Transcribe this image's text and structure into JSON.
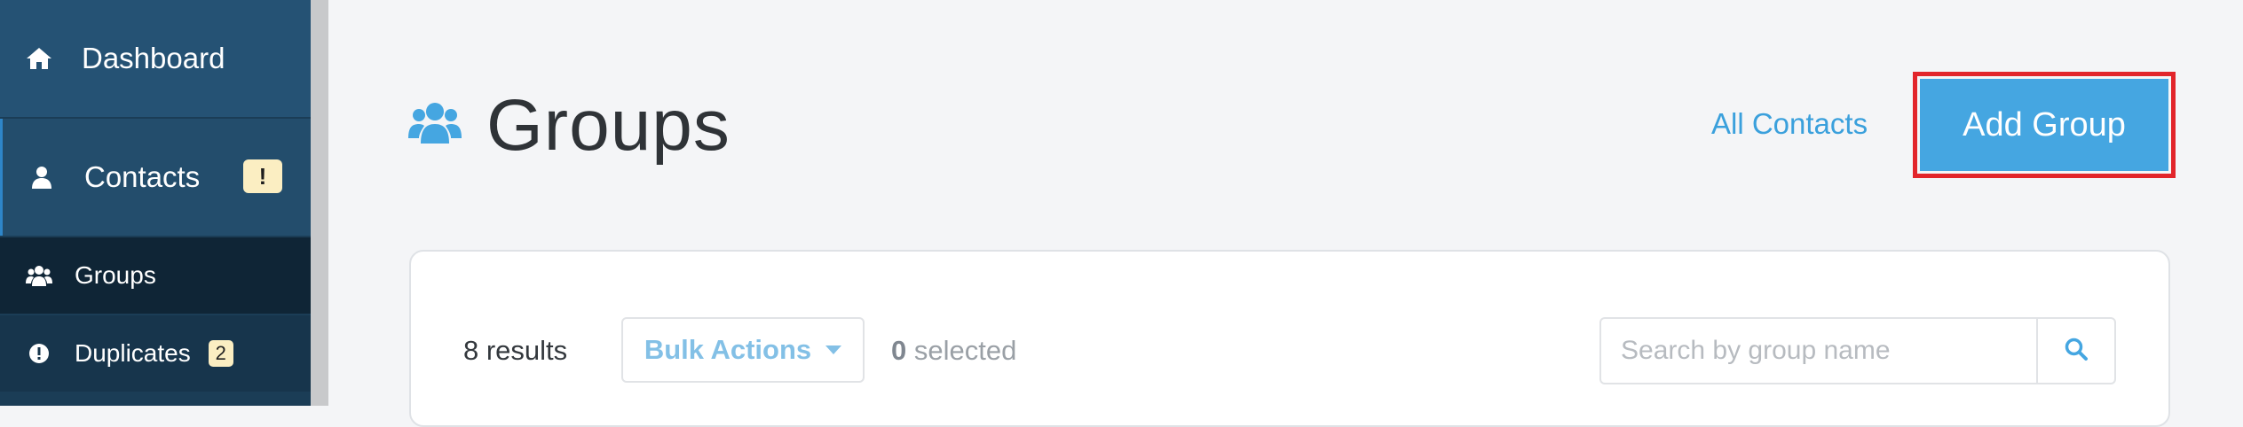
{
  "sidebar": {
    "items": [
      {
        "label": "Dashboard",
        "icon": "home-icon"
      },
      {
        "label": "Contacts",
        "icon": "user-icon",
        "badge": "!"
      },
      {
        "label": "Groups",
        "icon": "users-icon"
      },
      {
        "label": "Duplicates",
        "icon": "exclamation-circle-icon",
        "badge": "2"
      }
    ]
  },
  "header": {
    "title": "Groups",
    "title_icon": "users-icon",
    "all_contacts_link": "All Contacts",
    "add_group_label": "Add Group"
  },
  "toolbar": {
    "results_count": "8",
    "results_suffix": " results",
    "bulk_actions_label": "Bulk Actions",
    "selected_count": "0",
    "selected_suffix": " selected",
    "search_placeholder": "Search by group name",
    "search_value": ""
  },
  "colors": {
    "accent": "#45a6e1",
    "link": "#3aa0dc",
    "sidebar_bg": "#1b3d56",
    "highlight_border": "#e2252b",
    "badge_bg": "#fbeec2"
  }
}
